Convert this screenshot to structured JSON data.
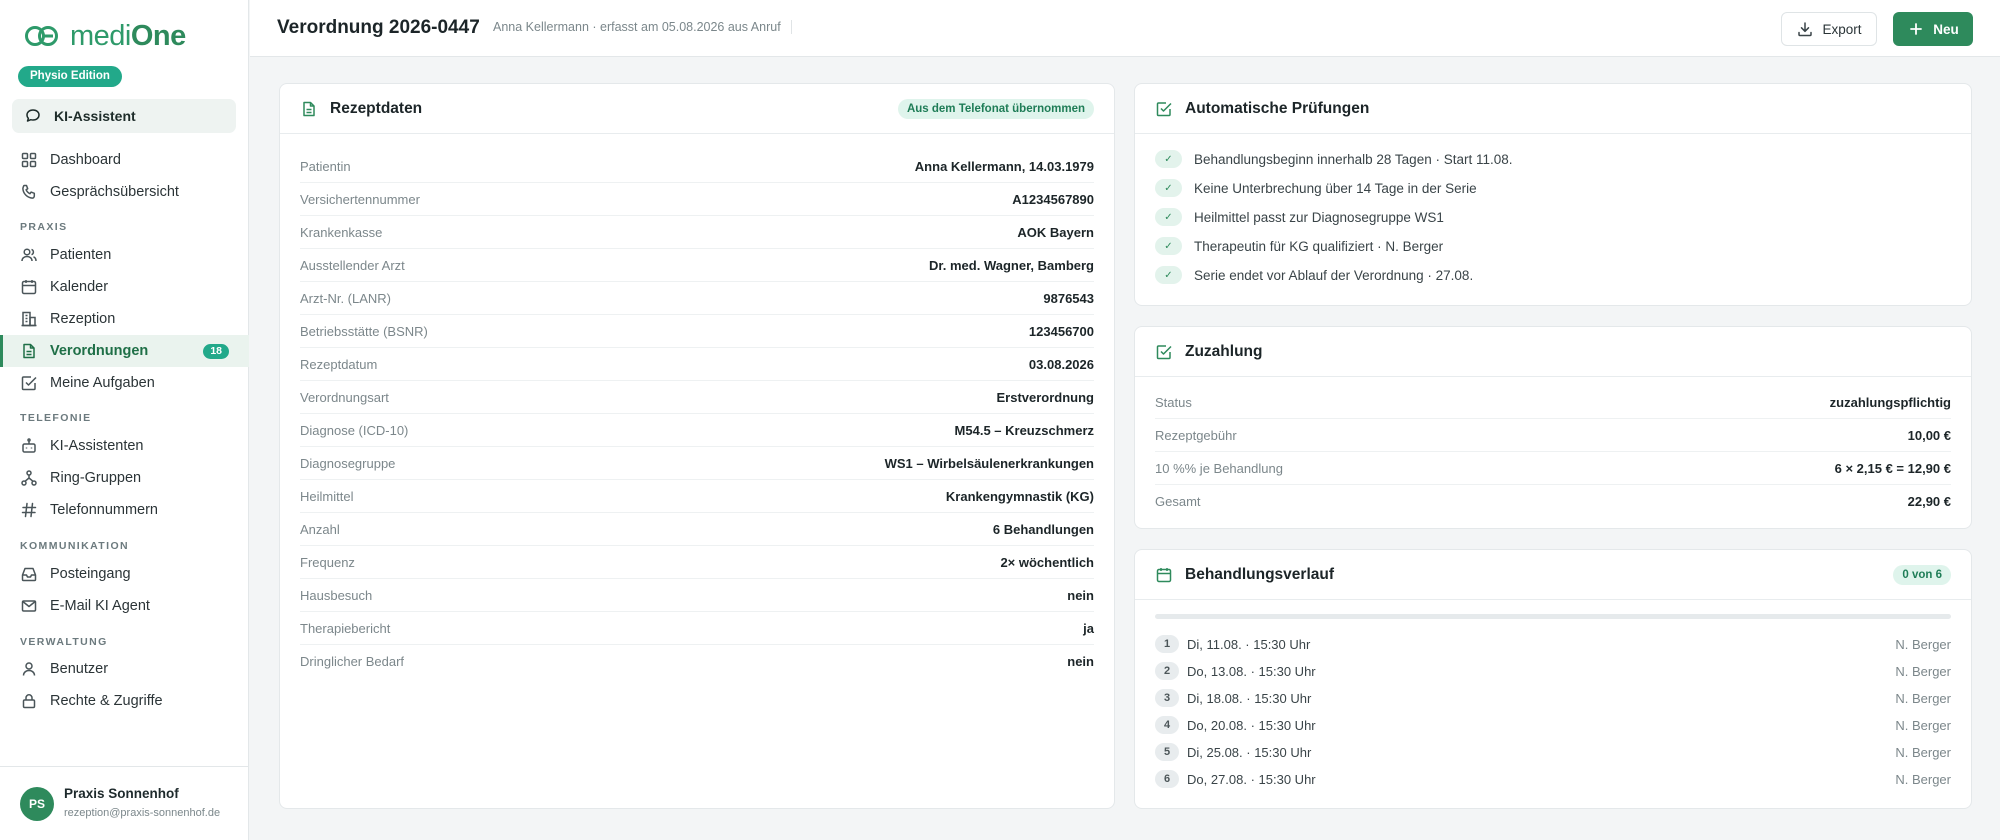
{
  "app": {
    "logo_text_light": "medi",
    "logo_text_bold": "One",
    "edition": "Physio Edition",
    "ki_assistant": "KI-Assistent",
    "accent_color": "#2e8a5c"
  },
  "sidebar": {
    "top_items": [
      {
        "label": "Dashboard",
        "icon": "dashboard-icon"
      },
      {
        "label": "Gesprächsübersicht",
        "icon": "phone-icon"
      }
    ],
    "sections": [
      {
        "label": "PRAXIS",
        "items": [
          {
            "label": "Patienten",
            "icon": "users-icon"
          },
          {
            "label": "Kalender",
            "icon": "calendar-icon"
          },
          {
            "label": "Rezeption",
            "icon": "building-icon"
          },
          {
            "label": "Verordnungen",
            "icon": "document-icon",
            "badge": "18",
            "active": true
          },
          {
            "label": "Meine Aufgaben",
            "icon": "checkbox-icon"
          }
        ]
      },
      {
        "label": "TELEFONIE",
        "items": [
          {
            "label": "KI-Assistenten",
            "icon": "bot-icon"
          },
          {
            "label": "Ring-Gruppen",
            "icon": "network-icon"
          },
          {
            "label": "Telefonnummern",
            "icon": "hash-icon"
          }
        ]
      },
      {
        "label": "KOMMUNIKATION",
        "items": [
          {
            "label": "Posteingang",
            "icon": "inbox-icon"
          },
          {
            "label": "E-Mail KI Agent",
            "icon": "mail-icon"
          }
        ]
      },
      {
        "label": "VERWALTUNG",
        "items": [
          {
            "label": "Benutzer",
            "icon": "user-icon"
          },
          {
            "label": "Rechte & Zugriffe",
            "icon": "lock-icon"
          }
        ]
      }
    ],
    "user": {
      "initials": "PS",
      "name": "Praxis Sonnenhof",
      "email": "rezeption@praxis-sonnenhof.de"
    }
  },
  "header": {
    "title": "Verordnung 2026-0447",
    "subtitle": "Anna Kellermann · erfasst am 05.08.2026 aus Anruf",
    "export_label": "Export",
    "new_label": "Neu"
  },
  "rezept": {
    "title": "Rezeptdaten",
    "pill": "Aus dem Telefonat übernommen",
    "rows": [
      {
        "label": "Patientin",
        "value": "Anna Kellermann, 14.03.1979"
      },
      {
        "label": "Versichertennummer",
        "value": "A1234567890"
      },
      {
        "label": "Krankenkasse",
        "value": "AOK Bayern"
      },
      {
        "label": "Ausstellender Arzt",
        "value": "Dr. med. Wagner, Bamberg"
      },
      {
        "label": "Arzt-Nr. (LANR)",
        "value": "9876543"
      },
      {
        "label": "Betriebsstätte (BSNR)",
        "value": "123456700"
      },
      {
        "label": "Rezeptdatum",
        "value": "03.08.2026"
      },
      {
        "label": "Verordnungsart",
        "value": "Erstverordnung"
      },
      {
        "label": "Diagnose (ICD-10)",
        "value": "M54.5 – Kreuzschmerz"
      },
      {
        "label": "Diagnosegruppe",
        "value": "WS1 – Wirbelsäulenerkrankungen"
      },
      {
        "label": "Heilmittel",
        "value": "Krankengymnastik (KG)"
      },
      {
        "label": "Anzahl",
        "value": "6 Behandlungen"
      },
      {
        "label": "Frequenz",
        "value": "2× wöchentlich"
      },
      {
        "label": "Hausbesuch",
        "value": "nein"
      },
      {
        "label": "Therapiebericht",
        "value": "ja"
      },
      {
        "label": "Dringlicher Bedarf",
        "value": "nein"
      }
    ]
  },
  "checks": {
    "title": "Automatische Prüfungen",
    "items": [
      {
        "mark": "✓",
        "text": "Behandlungsbeginn innerhalb 28 Tagen · Start 11.08."
      },
      {
        "mark": "✓",
        "text": "Keine Unterbrechung über 14 Tage in der Serie"
      },
      {
        "mark": "✓",
        "text": "Heilmittel passt zur Diagnosegruppe WS1"
      },
      {
        "mark": "✓",
        "text": "Therapeutin für KG qualifiziert · N. Berger"
      },
      {
        "mark": "✓",
        "text": "Serie endet vor Ablauf der Verordnung · 27.08."
      }
    ]
  },
  "zuzahlung": {
    "title": "Zuzahlung",
    "rows": [
      {
        "label": "Status",
        "value": "zuzahlungspflichtig"
      },
      {
        "label": "Rezeptgebühr",
        "value": "10,00 €"
      },
      {
        "label": "10 %% je Behandlung",
        "value": "6 × 2,15 € = 12,90 €"
      },
      {
        "label": "Gesamt",
        "value": "22,90 €"
      }
    ]
  },
  "verlauf": {
    "title": "Behandlungsverlauf",
    "pill": "0 von 6",
    "progress": 0,
    "items": [
      {
        "num": "1",
        "date": "Di, 11.08. · 15:30 Uhr",
        "therapist": "N. Berger"
      },
      {
        "num": "2",
        "date": "Do, 13.08. · 15:30 Uhr",
        "therapist": "N. Berger"
      },
      {
        "num": "3",
        "date": "Di, 18.08. · 15:30 Uhr",
        "therapist": "N. Berger"
      },
      {
        "num": "4",
        "date": "Do, 20.08. · 15:30 Uhr",
        "therapist": "N. Berger"
      },
      {
        "num": "5",
        "date": "Di, 25.08. · 15:30 Uhr",
        "therapist": "N. Berger"
      },
      {
        "num": "6",
        "date": "Do, 27.08. · 15:30 Uhr",
        "therapist": "N. Berger"
      }
    ]
  }
}
